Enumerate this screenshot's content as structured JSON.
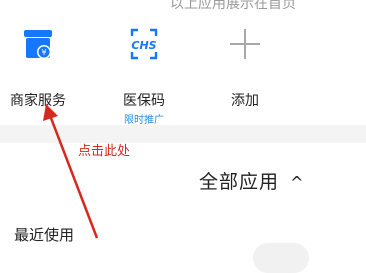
{
  "top_hint": "以上应用展示在首页",
  "apps": [
    {
      "label": "商家服务",
      "icon": "merchant-shop-icon",
      "color": "#1677ff"
    },
    {
      "label": "医保码",
      "sub": "限时推广",
      "icon": "chs-medical-insurance-icon",
      "color": "#1677ff"
    },
    {
      "label": "添加",
      "icon": "plus-icon",
      "color": "#a8a8a8"
    }
  ],
  "annotation": {
    "text": "点击此处",
    "color": "#d42a1e"
  },
  "section": {
    "title": "全部应用",
    "chevron": "^"
  },
  "recent": {
    "label": "最近使用"
  }
}
